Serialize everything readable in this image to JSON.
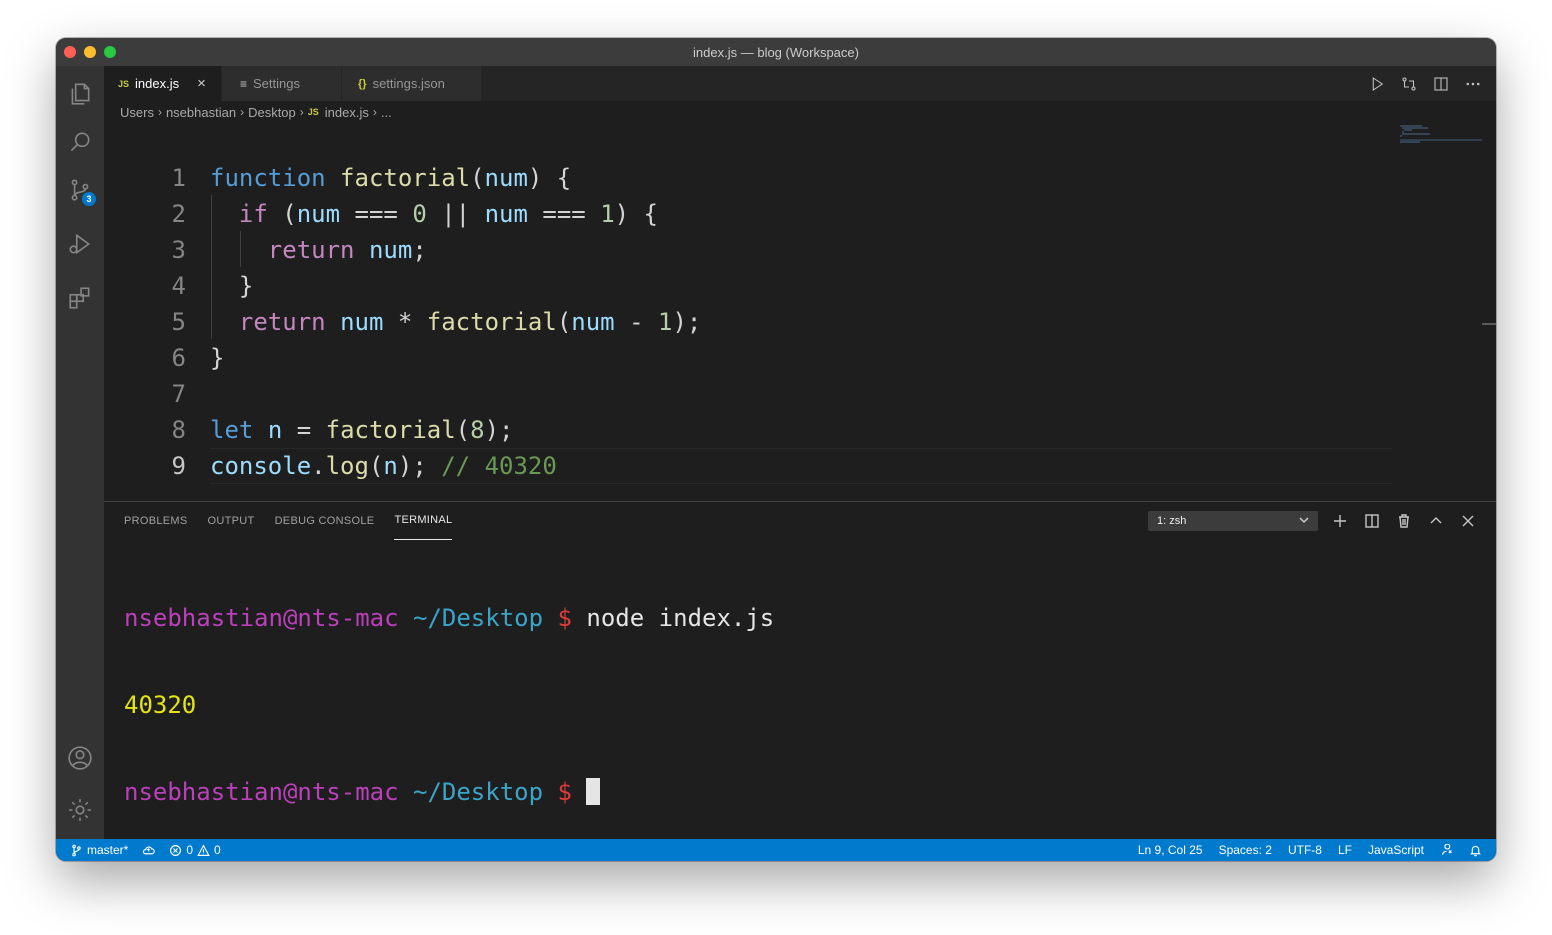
{
  "window": {
    "title": "index.js — blog (Workspace)"
  },
  "activity_bar": {
    "items": [
      {
        "name": "explorer",
        "icon": "files-icon"
      },
      {
        "name": "search",
        "icon": "search-icon"
      },
      {
        "name": "source-control",
        "icon": "source-control-icon",
        "badge": "3"
      },
      {
        "name": "run-debug",
        "icon": "run-debug-icon"
      },
      {
        "name": "extensions",
        "icon": "extensions-icon"
      }
    ],
    "bottom": [
      {
        "name": "accounts",
        "icon": "account-icon"
      },
      {
        "name": "manage",
        "icon": "gear-icon"
      }
    ]
  },
  "tabs": [
    {
      "label": "index.js",
      "icon": "JS",
      "active": true,
      "close": "×"
    },
    {
      "label": "Settings",
      "icon": "≡",
      "active": false
    },
    {
      "label": "settings.json",
      "icon": "{}",
      "active": false
    }
  ],
  "breadcrumb": {
    "items": [
      "Users",
      "nsebhastian",
      "Desktop"
    ],
    "file_icon": "JS",
    "file": "index.js",
    "more": "..."
  },
  "editor": {
    "line_numbers": [
      "1",
      "2",
      "3",
      "4",
      "5",
      "6",
      "7",
      "8",
      "9"
    ],
    "current_line": 9,
    "lines": [
      "function factorial(num) {",
      "  if (num === 0 || num === 1) {",
      "    return num;",
      "  }",
      "  return num * factorial(num - 1);",
      "}",
      "",
      "let n = factorial(8);",
      "console.log(n); // 40320"
    ]
  },
  "panel": {
    "tabs": [
      "PROBLEMS",
      "OUTPUT",
      "DEBUG CONSOLE",
      "TERMINAL"
    ],
    "active_tab": "TERMINAL",
    "terminal_select": "1: zsh",
    "terminal": {
      "user": "nsebhastian@nts-mac",
      "path": "~/Desktop",
      "prompt": "$",
      "command": "node index.js",
      "output": "40320"
    }
  },
  "status_bar": {
    "branch": "master*",
    "errors": "0",
    "warnings": "0",
    "position": "Ln 9, Col 25",
    "spaces": "Spaces: 2",
    "encoding": "UTF-8",
    "eol": "LF",
    "language": "JavaScript"
  },
  "colors": {
    "accent": "#007acc",
    "keyword_blue": "#569cd6",
    "keyword_purple": "#c586c0",
    "function": "#dcdcaa",
    "variable": "#9cdcfe",
    "number": "#b5cea8",
    "comment": "#6a9955"
  }
}
